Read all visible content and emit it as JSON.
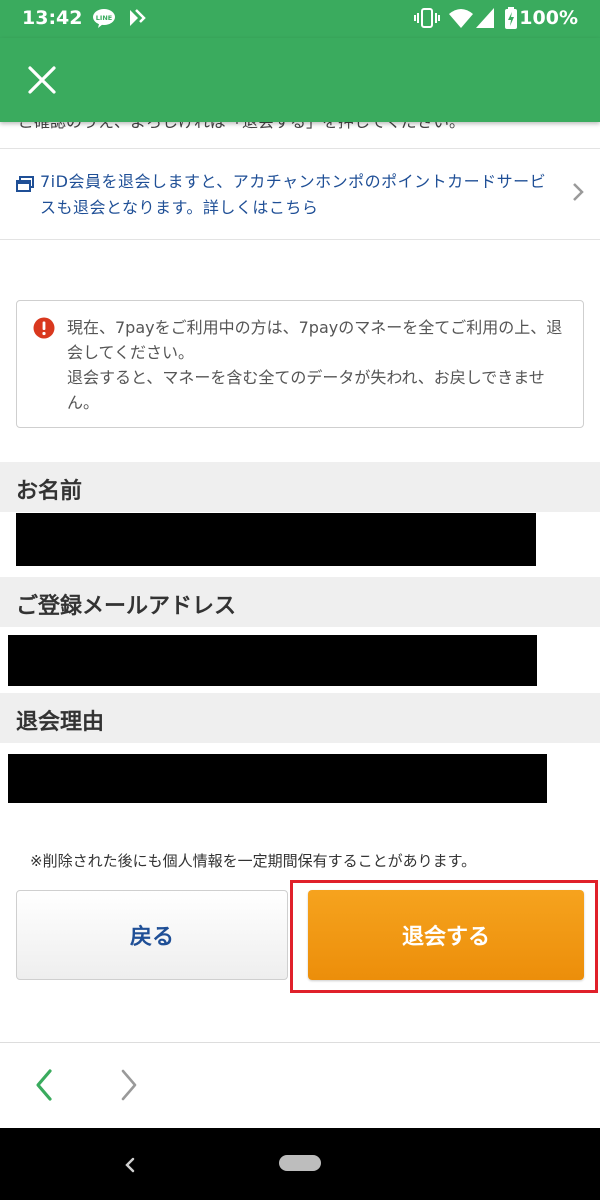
{
  "status_bar": {
    "time": "13:42",
    "battery": "100%",
    "icons": [
      "line-icon",
      "notification-icon",
      "vibrate-icon",
      "wifi-icon",
      "cell-signal-icon",
      "battery-icon"
    ]
  },
  "app_bar": {
    "close_icon": "close-icon",
    "color": "#3aab5e"
  },
  "cut_off_text": "ご確認のうえ、よろしければ「退会する」を押してください。",
  "info_link": {
    "text": "7iD会員を退会しますと、アカチャンホンポのポイントカードサービスも退会となります。詳しくはこちら",
    "icon": "external-window-icon"
  },
  "notice": {
    "icon": "warning-icon",
    "line1": "現在、7payをご利用中の方は、7payのマネーを全てご利用の上、退会してください。",
    "line2": "退会すると、マネーを含む全てのデータが失われ、お戻しできません。"
  },
  "sections": {
    "name_label": "お名前",
    "email_label": "ご登録メールアドレス",
    "reason_label": "退会理由"
  },
  "disclaimer": "※削除された後にも個人情報を一定期間保有することがあります。",
  "buttons": {
    "back": "戻る",
    "withdraw": "退会する"
  },
  "colors": {
    "accent_green": "#3aab5e",
    "link_blue": "#1f4f96",
    "withdraw_orange": "#f39a16",
    "highlight_red": "#e0202a",
    "warning_red": "#d9381e"
  }
}
